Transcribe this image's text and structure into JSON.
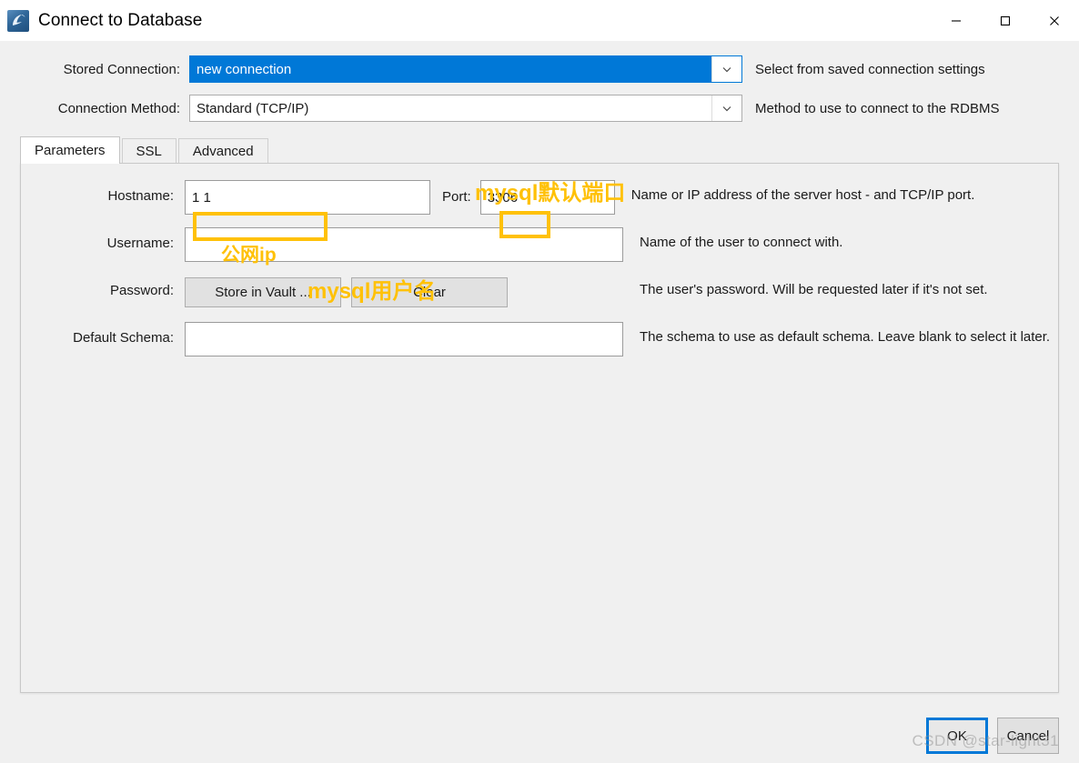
{
  "window": {
    "title": "Connect to Database",
    "icon": "mysql-workbench-dolphin-icon",
    "minimize_label": "—",
    "maximize_label": "☐",
    "close_label": "✕"
  },
  "top": {
    "stored_connection": {
      "label": "Stored Connection:",
      "value": "new connection",
      "hint": "Select from saved connection settings",
      "selected": true
    },
    "connection_method": {
      "label": "Connection Method:",
      "value": "Standard (TCP/IP)",
      "hint": "Method to use to connect to the RDBMS"
    }
  },
  "tabs": [
    {
      "label": "Parameters",
      "active": true
    },
    {
      "label": "SSL",
      "active": false
    },
    {
      "label": "Advanced",
      "active": false
    }
  ],
  "parameters": {
    "hostname": {
      "label": "Hostname:",
      "value": "1                    1",
      "desc": "Name or IP address of the server host - and TCP/IP port."
    },
    "port": {
      "label": "Port:",
      "value": "3306"
    },
    "username": {
      "label": "Username:",
      "value": "",
      "desc": "Name of the user to connect with."
    },
    "password": {
      "label": "Password:",
      "store_button": "Store in Vault ...",
      "clear_button": "Clear",
      "desc": "The user's password. Will be requested later if it's not set."
    },
    "default_schema": {
      "label": "Default Schema:",
      "value": "",
      "desc": "The schema to use as default schema. Leave blank to select it later."
    }
  },
  "annotations": {
    "color": "#ffc107",
    "port_note": "mysql默认端口",
    "hostname_note": "公网ip",
    "username_note": "mysql用户名"
  },
  "footer": {
    "ok_label": "OK",
    "cancel_label": "Cancel",
    "watermark": "CSDN @star-light31"
  }
}
